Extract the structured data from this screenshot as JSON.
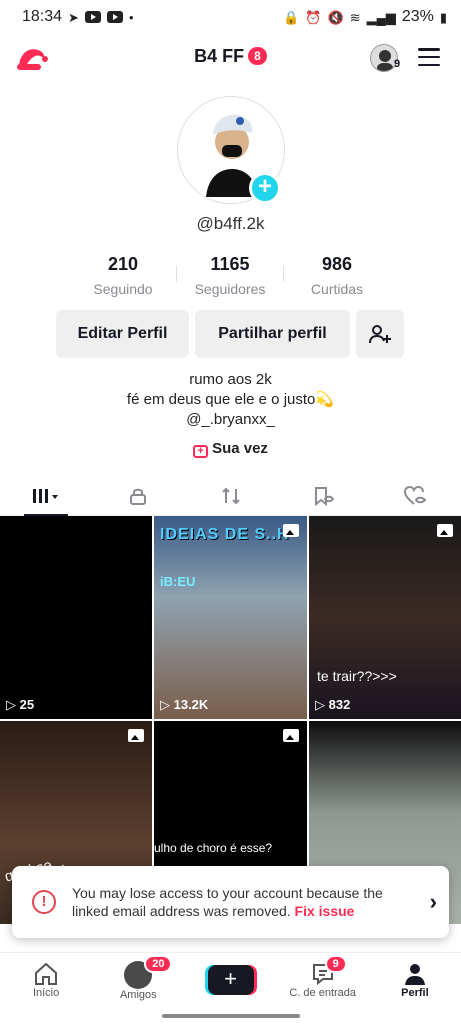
{
  "status_bar": {
    "time": "18:34",
    "battery": "23%"
  },
  "header": {
    "account_name": "B4 FF",
    "notification_count": "8",
    "accounts_count": "9"
  },
  "profile": {
    "username": "@b4ff.2k",
    "stats": [
      {
        "value": "210",
        "label": "Seguindo"
      },
      {
        "value": "1165",
        "label": "Seguidores"
      },
      {
        "value": "986",
        "label": "Curtidas"
      }
    ],
    "buttons": {
      "edit": "Editar Perfil",
      "share": "Partilhar perfil"
    },
    "bio_lines": [
      "rumo aos 2k",
      "fé em deus que ele e o justo💫",
      "@_.bryanxx_"
    ],
    "your_turn": "Sua vez"
  },
  "videos": [
    {
      "views": "25"
    },
    {
      "views": "13.2K",
      "title": "IDEIAS DE S..H",
      "subtitle": "iB:EU"
    },
    {
      "views": "832",
      "caption": "te trair??>>>"
    },
    {
      "caption": "qual se..."
    },
    {
      "caption": "ulho de choro é esse?"
    },
    {}
  ],
  "warning": {
    "text": "You may lose access to your account because the linked email address was removed.",
    "action": "Fix issue"
  },
  "nav": {
    "home": "Início",
    "friends": "Amigos",
    "friends_badge": "20",
    "inbox": "C. de entrada",
    "inbox_badge": "9",
    "profile": "Perfil"
  },
  "colors": {
    "accent": "#fe2c55",
    "cyan": "#20d5ec"
  }
}
